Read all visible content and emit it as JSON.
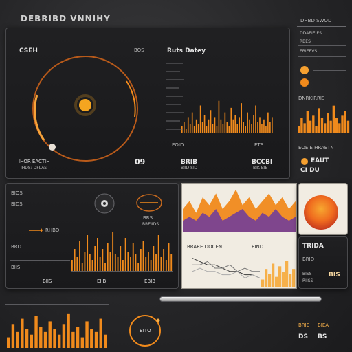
{
  "header": {
    "title": "DEBRIBD VNNIHY"
  },
  "top_right": {
    "label": "DHBD SWOD"
  },
  "main_panel": {
    "gauge_label": "CSEH",
    "gauge_badge": "BOS",
    "chart_title": "Ruts Datey",
    "footer_left": "IHOR EACTIH",
    "footer_left_sub": "IHDS: DFLAS",
    "footer_mid": "09",
    "footer_mid2": "BRIB",
    "footer_mid2_sub": "BIID SID",
    "footer_right": "BCCBI",
    "footer_right_sub": "BIK BIE",
    "axis_left": "EOID",
    "axis_right": "ETS"
  },
  "right_col": {
    "row1": "DDAEIEIES",
    "row2": "RBES",
    "row3": "EBIEEVS",
    "chart_title": "DNRKIRRIS",
    "section": "EOEIE HRAETN",
    "stat1": "EAUT",
    "stat2": "CI DU"
  },
  "lower_left": {
    "label1": "BIOS",
    "label2": "BIDS",
    "label3": "RHBO",
    "label4": "BRD",
    "label5": "BIIS",
    "badge_text": "BRS",
    "badge_sub": "BREIIDS",
    "foot1": "BIIS",
    "foot2": "EIIB",
    "foot3": "EBIB"
  },
  "lower_mid": {
    "chart_title": "BRARE DOCEN",
    "chart_aux": "EIND"
  },
  "lower_right": {
    "title": "TRIDA",
    "sub": "BRID",
    "val": "BIS",
    "legend1": "BISS",
    "legend2": "RIISS"
  },
  "bottom": {
    "dial_text": "BITO",
    "stat1": "BRIE",
    "stat2": "BIEA",
    "val1": "DS",
    "val2": "BS"
  },
  "chart_data": [
    {
      "type": "bar",
      "values": [
        3,
        5,
        2,
        7,
        4,
        9,
        3,
        6,
        4,
        12,
        5,
        8,
        3,
        6,
        10,
        4,
        7,
        3,
        14,
        6,
        4,
        9,
        5,
        3,
        11,
        6,
        8,
        4,
        7,
        13,
        5,
        3,
        9,
        6,
        4,
        8,
        12,
        5,
        7,
        4,
        6,
        3,
        9,
        5,
        7
      ],
      "ylim": [
        0,
        16
      ]
    },
    {
      "type": "bar",
      "values": [
        3,
        6,
        4,
        9,
        5,
        7,
        3,
        10,
        6,
        4,
        8,
        5,
        11,
        6,
        4,
        7,
        9,
        5
      ],
      "ylim": [
        0,
        12
      ]
    },
    {
      "type": "bar",
      "values": [
        4,
        8,
        5,
        11,
        3,
        7,
        13,
        6,
        4,
        9,
        12,
        5,
        8,
        3,
        10,
        7,
        14,
        6,
        5,
        9,
        4,
        12,
        7,
        5,
        10,
        6,
        3,
        8,
        11,
        5,
        7,
        4,
        9,
        6,
        13,
        5,
        8,
        4,
        10,
        6
      ],
      "ylim": [
        0,
        16
      ]
    },
    {
      "type": "area",
      "series": [
        {
          "values": [
            6,
            8,
            5,
            9,
            7,
            10,
            6,
            8,
            11,
            7,
            9,
            6,
            8,
            10,
            7,
            9,
            6,
            8
          ]
        },
        {
          "values": [
            3,
            4,
            3,
            5,
            4,
            6,
            3,
            4,
            5,
            6,
            4,
            3,
            5,
            4,
            6,
            4,
            3,
            4
          ]
        }
      ],
      "ylim": [
        0,
        12
      ]
    },
    {
      "type": "bar",
      "values": [
        4,
        9,
        6,
        11,
        7,
        5,
        12,
        8,
        6,
        10,
        7,
        5,
        9,
        13,
        6,
        8,
        4,
        10,
        7,
        6,
        11,
        5
      ],
      "ylim": [
        0,
        14
      ]
    },
    {
      "type": "bar",
      "values": [
        3,
        7,
        5,
        9,
        4,
        8,
        6,
        10,
        5,
        7
      ],
      "ylim": [
        0,
        12
      ]
    },
    {
      "type": "line",
      "series": [
        {
          "values": [
            8,
            7,
            6,
            6,
            5,
            4,
            4,
            3,
            3,
            2
          ]
        },
        {
          "values": [
            6,
            6,
            7,
            5,
            5,
            6,
            4,
            5,
            4,
            4
          ]
        },
        {
          "values": [
            4,
            5,
            4,
            4,
            3,
            3,
            4,
            2,
            3,
            2
          ]
        }
      ],
      "ylim": [
        0,
        10
      ]
    }
  ],
  "colors": {
    "accent": "#f08a1c",
    "accent_light": "#f6b04a",
    "purple": "#6b3aa0",
    "bg": "#262628",
    "panel": "#1b1b1d"
  }
}
